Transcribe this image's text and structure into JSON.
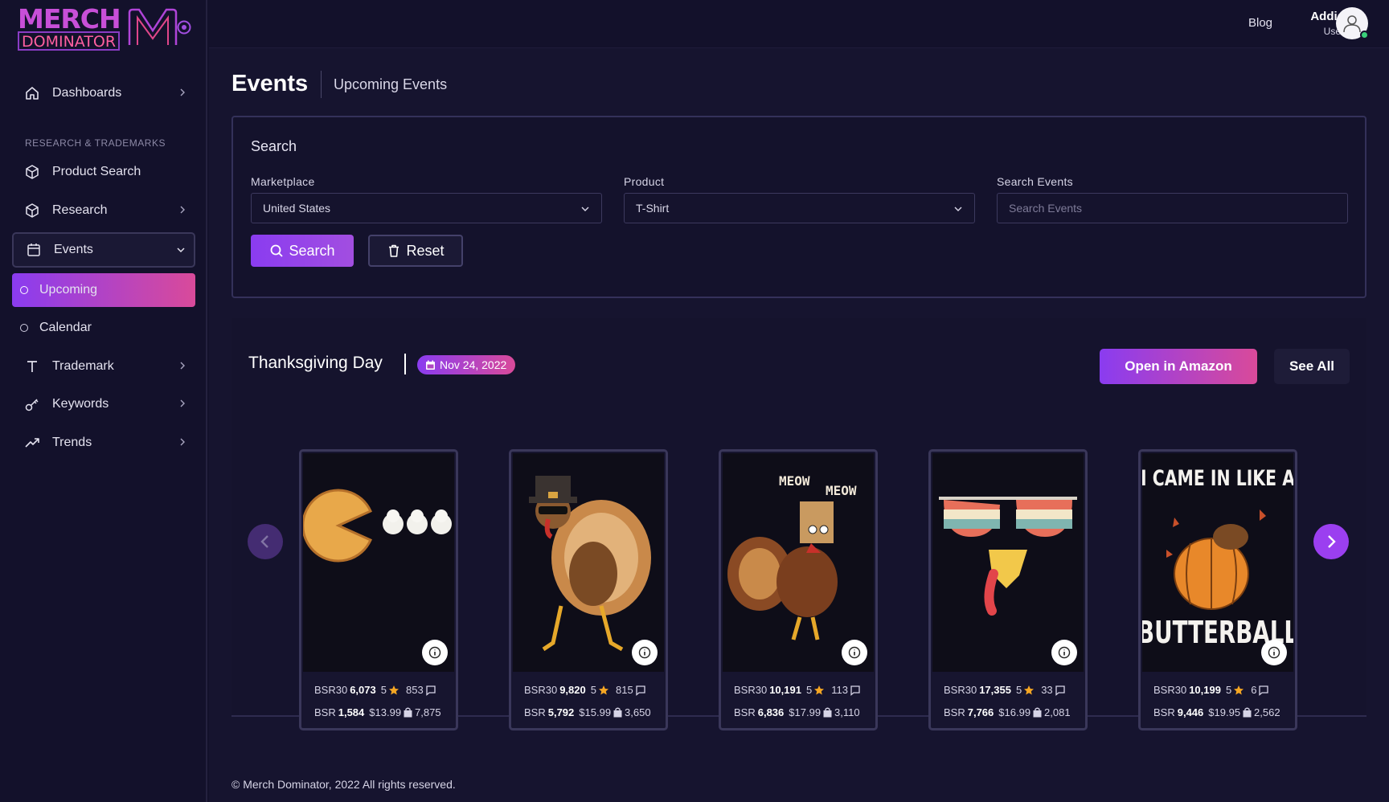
{
  "brand": {
    "logo_top": "MERCH",
    "logo_bottom": "DOMINATOR",
    "accent": "#8a3cf0",
    "accent2": "#d94a9a"
  },
  "sidebar": {
    "section_label": "RESEARCH & TRADEMARKS",
    "items": [
      {
        "label": "Dashboards",
        "icon": "home-icon"
      },
      {
        "label": "Product Search",
        "icon": "box-icon"
      },
      {
        "label": "Research",
        "icon": "box-icon"
      },
      {
        "label": "Events",
        "icon": "calendar-icon"
      },
      {
        "label": "Trademark",
        "icon": "text-icon"
      },
      {
        "label": "Keywords",
        "icon": "key-icon"
      },
      {
        "label": "Trends",
        "icon": "trend-icon"
      }
    ],
    "events_sub": [
      {
        "label": "Upcoming"
      },
      {
        "label": "Calendar"
      }
    ]
  },
  "topbar": {
    "blog": "Blog",
    "user_name": "Addie",
    "user_role": "User"
  },
  "page": {
    "title": "Events",
    "subtitle": "Upcoming Events"
  },
  "search": {
    "title": "Search",
    "marketplace_label": "Marketplace",
    "marketplace_value": "United States",
    "product_label": "Product",
    "product_value": "T-Shirt",
    "events_label": "Search Events",
    "events_placeholder": "Search Events",
    "search_button": "Search",
    "reset_button": "Reset"
  },
  "event": {
    "name": "Thanksgiving Day",
    "date": "Nov 24, 2022",
    "open_amazon": "Open in Amazon",
    "see_all": "See All",
    "products": [
      {
        "bsr30": "6,073",
        "rating": "5",
        "reviews": "853",
        "bsr": "1,584",
        "price": "$13.99",
        "sales": "7,875",
        "design": "pie"
      },
      {
        "bsr30": "9,820",
        "rating": "5",
        "reviews": "815",
        "bsr": "5,792",
        "price": "$15.99",
        "sales": "3,650",
        "design": "turkey"
      },
      {
        "bsr30": "10,191",
        "rating": "5",
        "reviews": "113",
        "bsr": "6,836",
        "price": "$17.99",
        "sales": "3,110",
        "design": "meow",
        "text1": "MEOW",
        "text2": "MEOW"
      },
      {
        "bsr30": "17,355",
        "rating": "5",
        "reviews": "33",
        "bsr": "7,766",
        "price": "$16.99",
        "sales": "2,081",
        "design": "sunglasses"
      },
      {
        "bsr30": "10,199",
        "rating": "5",
        "reviews": "6",
        "bsr": "9,446",
        "price": "$19.95",
        "sales": "2,562",
        "design": "butterball",
        "text1": "I CAME IN LIKE A",
        "text2": "BUTTERBALL"
      }
    ]
  },
  "footer": "© Merch Dominator, 2022 All rights reserved."
}
